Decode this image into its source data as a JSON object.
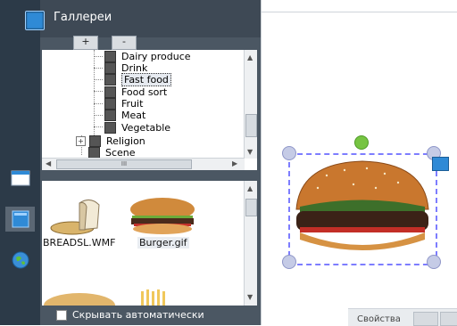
{
  "panel": {
    "title": "Галлереи",
    "plus": "+",
    "minus": "-",
    "autohide_label": "Скрывать автоматически"
  },
  "tree": {
    "items": [
      {
        "label": "Dairy produce"
      },
      {
        "label": "Drink"
      },
      {
        "label": "Fast food",
        "selected": true
      },
      {
        "label": "Food sort"
      },
      {
        "label": "Fruit"
      },
      {
        "label": "Meat"
      },
      {
        "label": "Vegetable"
      },
      {
        "label": "Religion",
        "expander": "+"
      },
      {
        "label": "Scene"
      }
    ],
    "h_scroll_thumb": "III"
  },
  "gallery": {
    "items": [
      {
        "label": "BREADSL.WMF"
      },
      {
        "label": "Burger.gif"
      }
    ]
  },
  "canvas": {
    "properties_label": "Свойства"
  },
  "colors": {
    "rail": "#2c3a48",
    "panel": "#4b5763",
    "accent": "#2f8ad6",
    "selection": "#7d7dff",
    "rotate_handle": "#76c442"
  },
  "icons": [
    "gallery-icon",
    "page-icon",
    "globe-icon",
    "folder-icon",
    "bread-icon",
    "burger-icon",
    "selection-menu-icon"
  ]
}
